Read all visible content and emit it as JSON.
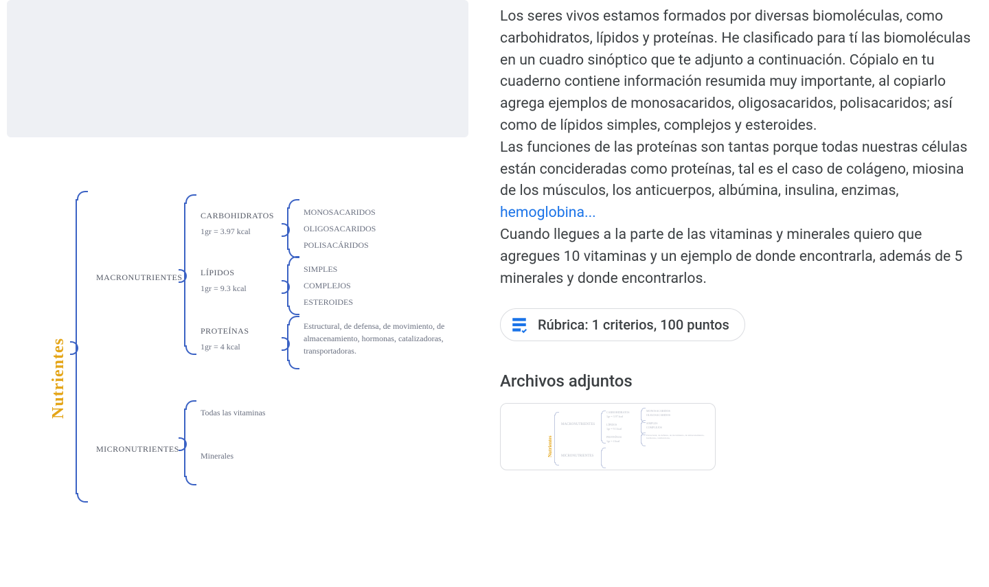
{
  "diagram": {
    "root_label": "Nutrientes",
    "macro": {
      "label": "MACRONUTRIENTES",
      "carbs": {
        "title": "CARBOHIDRATOS",
        "kcal": "1gr = 3.97 kcal",
        "items": [
          "MONOSACARIDOS",
          "OLIGOSACARIDOS",
          "POLISACÁRIDOS"
        ]
      },
      "lipids": {
        "title": "LÍPIDOS",
        "kcal": "1gr = 9.3 kcal",
        "items": [
          "SIMPLES",
          "COMPLEJOS",
          "ESTEROIDES"
        ]
      },
      "proteins": {
        "title": "PROTEÍNAS",
        "kcal": "1gr = 4 kcal",
        "desc": "Estructural, de defensa, de movimiento, de almacenamiento, hormonas, catalizadoras, transportadoras."
      }
    },
    "micro": {
      "label": "MICRONUTRIENTES",
      "vitamins": "Todas las vitaminas",
      "minerals": "Minerales"
    }
  },
  "description": {
    "p1": "Los seres vivos estamos formados por diversas biomoléculas, como carbohidratos, lípidos y proteínas. He clasificado para tí las biomoléculas en un cuadro sinóptico que te adjunto a continuación. Cópialo en tu cuaderno contiene información resumida muy importante, al copiarlo agrega ejemplos de monosacaridos, oligosacaridos, polisacaridos; así como de lípidos simples, complejos y esteroides.",
    "p2a": "Las funciones de las proteínas son tantas porque todas nuestras células están concideradas como proteínas, tal es el caso de colágeno, miosina de los músculos, los anticuerpos, albúmina, insulina, enzimas, ",
    "linkText": "hemoglobina...",
    "p3": "Cuando llegues a la parte de las vitaminas y minerales quiero que agregues 10 vitaminas y un ejemplo de donde encontrarla, además de 5 minerales y donde encontrarlos."
  },
  "rubric": {
    "label": "Rúbrica: 1 criterios, 100 puntos"
  },
  "attachments": {
    "heading": "Archivos adjuntos"
  }
}
